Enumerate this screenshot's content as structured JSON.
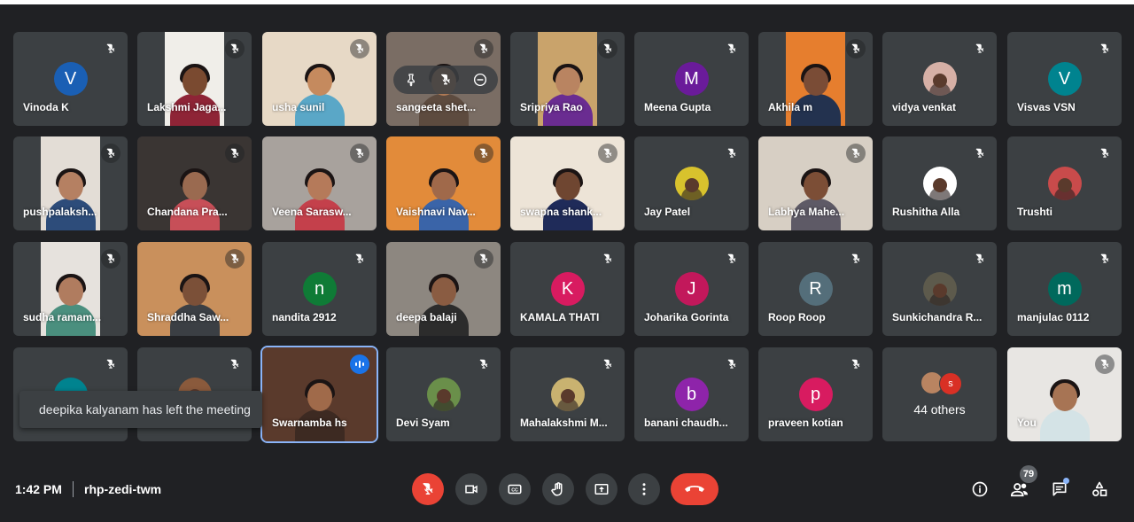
{
  "tiles": [
    {
      "name": "Vinoda K",
      "type": "avatar",
      "initial": "V",
      "color": "#1a5fb4"
    },
    {
      "name": "Lakshmi Jaga...",
      "type": "video",
      "bg": "#f0eee9",
      "skin": "#7a4a30",
      "body": "#8e2436"
    },
    {
      "name": "usha sunil",
      "type": "video",
      "bg": "#e7d9c6",
      "skin": "#c58a5e",
      "body": "#5aa7c7"
    },
    {
      "name": "sangeeta shet...",
      "type": "video",
      "bg": "#7a6d64",
      "skin": "#b07a55",
      "body": "#5d4b3f",
      "hover": true
    },
    {
      "name": "Sripriya Rao",
      "type": "video",
      "bg": "#c9a36b",
      "skin": "#b98461",
      "body": "#6a2c91"
    },
    {
      "name": "Meena Gupta",
      "type": "avatar",
      "initial": "M",
      "color": "#6a1b9a"
    },
    {
      "name": "Akhila m",
      "type": "video",
      "bg": "#e67e2e",
      "skin": "#7a4c36",
      "body": "#23324f"
    },
    {
      "name": "vidya venkat",
      "type": "photo",
      "color": "#d6b0a6"
    },
    {
      "name": "Visvas VSN",
      "type": "avatar",
      "initial": "V",
      "color": "#00838f"
    },
    {
      "name": "pushpalaksh...",
      "type": "video",
      "bg": "#e3ddd6",
      "skin": "#b58062",
      "body": "#2d4c7a"
    },
    {
      "name": "Chandana Pra...",
      "type": "video",
      "bg": "#3a3533",
      "skin": "#9a6a50",
      "body": "#c74f58"
    },
    {
      "name": "Veena Sarasw...",
      "type": "video",
      "bg": "#a8a29d",
      "skin": "#b57a5a",
      "body": "#c4404b"
    },
    {
      "name": "Vaishnavi Nav...",
      "type": "video",
      "bg": "#e28b3a",
      "skin": "#a0694a",
      "body": "#3a64a8"
    },
    {
      "name": "swapna shank...",
      "type": "video",
      "bg": "#ede4d7",
      "skin": "#6f4631",
      "body": "#1f2b59"
    },
    {
      "name": "Jay Patel",
      "type": "photo",
      "color": "#d8c22d"
    },
    {
      "name": "Labhya Mahe...",
      "type": "video",
      "bg": "#d7cfc4",
      "skin": "#7c4e36",
      "body": "#5e5a66"
    },
    {
      "name": "Rushitha Alla",
      "type": "photo",
      "color": "#ffffff"
    },
    {
      "name": "Trushti",
      "type": "photo",
      "color": "#c94b4b"
    },
    {
      "name": "sudha ramam...",
      "type": "video",
      "bg": "#e6e2dd",
      "skin": "#b07c5f",
      "body": "#4a8f7e"
    },
    {
      "name": "Shraddha Saw...",
      "type": "video",
      "bg": "#c9905c",
      "skin": "#7b5038",
      "body": "#3b3f44"
    },
    {
      "name": "nandita 2912",
      "type": "avatar",
      "initial": "n",
      "color": "#0f7b36"
    },
    {
      "name": "deepa balaji",
      "type": "video",
      "bg": "#8d8780",
      "skin": "#8a5c42",
      "body": "#2c2c2c"
    },
    {
      "name": "KAMALA THATI",
      "type": "avatar",
      "initial": "K",
      "color": "#d81b60"
    },
    {
      "name": "Joharika Gorinta",
      "type": "avatar",
      "initial": "J",
      "color": "#c2185b"
    },
    {
      "name": "Roop Roop",
      "type": "avatar",
      "initial": "R",
      "color": "#546e7a"
    },
    {
      "name": "Sunkichandra R...",
      "type": "photo",
      "color": "#5d5a4c"
    },
    {
      "name": "manjulac 0112",
      "type": "avatar",
      "initial": "m",
      "color": "#00695c"
    },
    {
      "name": "",
      "type": "avatar",
      "initial": "",
      "color": "#00838f"
    },
    {
      "name": "",
      "type": "photo",
      "color": "#8a5a3c"
    },
    {
      "name": "Swarnamba hs",
      "type": "video",
      "bg": "#5a3a2c",
      "skin": "#a06a4a",
      "body": "#3d2a22",
      "speaking": true
    },
    {
      "name": "Devi Syam",
      "type": "photo",
      "color": "#6a8f4a"
    },
    {
      "name": "Mahalakshmi M...",
      "type": "photo",
      "color": "#c9b270"
    },
    {
      "name": "banani chaudh...",
      "type": "avatar",
      "initial": "b",
      "color": "#8e24aa"
    },
    {
      "name": "praveen kotian",
      "type": "avatar",
      "initial": "p",
      "color": "#d81b60"
    },
    {
      "name": "44 others",
      "type": "others"
    },
    {
      "name": "You",
      "type": "video",
      "bg": "#e8e6e3",
      "skin": "#a77454",
      "body": "#d4e3e6"
    }
  ],
  "others": {
    "second_initial": "s",
    "second_color": "#d93025"
  },
  "toast": "deepika kalyanam has left the meeting",
  "time": "1:42 PM",
  "meeting_code": "rhp-zedi-twm",
  "participants_count": "79",
  "icons": {
    "mic_off": "mic-off-icon",
    "camera": "videocam-icon",
    "captions": "captions-icon",
    "raise_hand": "hand-icon",
    "present": "present-icon",
    "more": "more-vert-icon",
    "end_call": "call-end-icon",
    "info": "info-icon",
    "people": "people-icon",
    "chat": "chat-icon",
    "activities": "activities-icon"
  },
  "colors": {
    "end_call": "#ea4335",
    "speaking": "#1a73e8",
    "background": "#202124",
    "tile": "#3c4043"
  }
}
